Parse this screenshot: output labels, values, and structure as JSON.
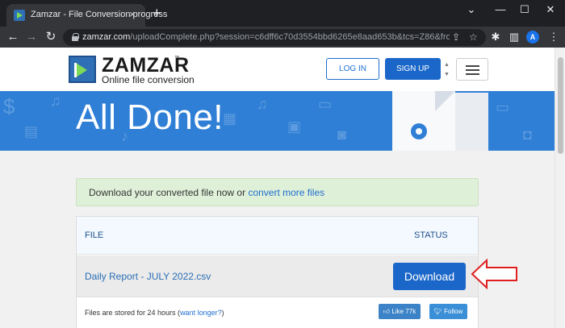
{
  "browser": {
    "tab": {
      "title": "Zamzar - File Conversion progress",
      "close_icon": "×"
    },
    "new_tab_icon": "+",
    "window_controls": {
      "collapse": "⌄",
      "minimize": "—",
      "maximize": "☐",
      "close": "✕"
    },
    "nav": {
      "back": "←",
      "forward": "→",
      "reload": "↻"
    },
    "address": {
      "host": "zamzar.com",
      "path": "/uploadComplete.php?session=c6dff6c70d3554bbd6265e8aad653b&tcs=Z86&from=..."
    },
    "toolbar_icons": [
      "share-icon",
      "star-icon",
      "extensions-icon",
      "sidebar-icon",
      "menu-icon"
    ],
    "profile_initial": "A"
  },
  "site": {
    "logo": {
      "name": "ZAMZAR",
      "tm": "™",
      "tagline": "Online file conversion"
    },
    "header": {
      "login_label": "LOG IN",
      "signup_label": "SIGN UP"
    },
    "banner": {
      "title": "All Done!"
    },
    "notice": {
      "text": "Download your converted file now or ",
      "link": "convert more files"
    },
    "table": {
      "col_file": "FILE",
      "col_status": "STATUS",
      "rows": [
        {
          "file_name": "Daily Report - JULY 2022.csv",
          "action_label": "Download"
        }
      ]
    },
    "footer": {
      "text": "Files are stored for 24 hours (",
      "link": "want longer?",
      "text_end": ")",
      "like_label": "Like 77k",
      "follow_label": "Follow"
    }
  },
  "colors": {
    "brand_blue": "#1b67c9",
    "banner_blue": "#2f7fd6",
    "notice_green": "#dff0d8",
    "callout_red": "#e02020"
  }
}
